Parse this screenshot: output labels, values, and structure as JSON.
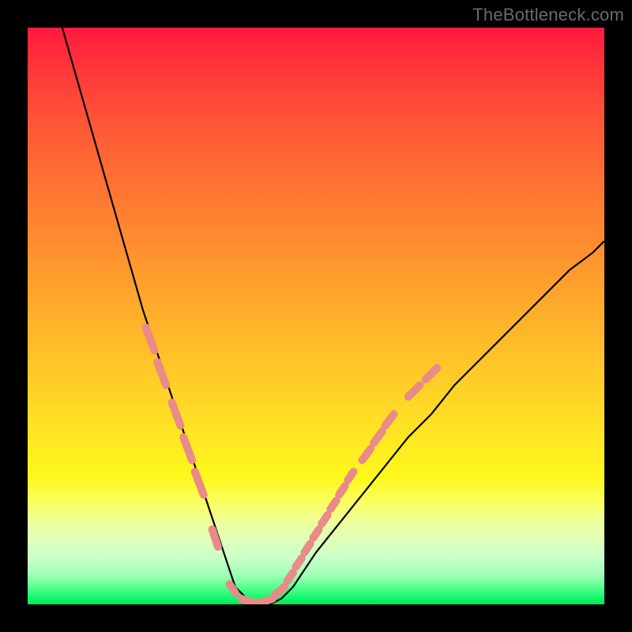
{
  "watermark": {
    "text": "TheBottleneck.com"
  },
  "chart_data": {
    "type": "line",
    "title": "",
    "xlabel": "",
    "ylabel": "",
    "xlim": [
      0,
      100
    ],
    "ylim": [
      0,
      100
    ],
    "grid": false,
    "legend": false,
    "annotations": [],
    "series": [
      {
        "name": "bottleneck-curve",
        "color": "#000000",
        "x": [
          6,
          8,
          10,
          12,
          14,
          16,
          18,
          20,
          22,
          24,
          26,
          28,
          30,
          32,
          33,
          34,
          35,
          36,
          38,
          40,
          42,
          44,
          46,
          48,
          50,
          54,
          58,
          62,
          66,
          70,
          74,
          78,
          82,
          86,
          90,
          94,
          98,
          100
        ],
        "y": [
          100,
          93,
          86,
          79,
          72,
          65,
          58,
          51,
          45,
          39,
          33,
          27,
          21,
          15,
          12,
          9,
          6,
          3,
          1,
          0,
          0,
          1,
          3,
          6,
          9,
          14,
          19,
          24,
          29,
          33,
          38,
          42,
          46,
          50,
          54,
          58,
          61,
          63
        ]
      },
      {
        "name": "salmon-dashes",
        "color": "#e98b87",
        "segments": [
          {
            "x": [
              20.5,
              22.0
            ],
            "y": [
              48.0,
              44.0
            ]
          },
          {
            "x": [
              22.5,
              24.0
            ],
            "y": [
              42.0,
              38.0
            ]
          },
          {
            "x": [
              25.0,
              26.5
            ],
            "y": [
              35.0,
              31.0
            ]
          },
          {
            "x": [
              27.0,
              28.5
            ],
            "y": [
              29.0,
              25.0
            ]
          },
          {
            "x": [
              29.0,
              30.5
            ],
            "y": [
              23.0,
              19.0
            ]
          },
          {
            "x": [
              32.0,
              33.0
            ],
            "y": [
              13.0,
              10.0
            ]
          },
          {
            "x": [
              35.0,
              36.0
            ],
            "y": [
              3.5,
              2.0
            ]
          },
          {
            "x": [
              37.0,
              38.5
            ],
            "y": [
              1.0,
              0.5
            ]
          },
          {
            "x": [
              39.0,
              40.5
            ],
            "y": [
              0.3,
              0.3
            ]
          },
          {
            "x": [
              41.0,
              42.5
            ],
            "y": [
              0.5,
              1.0
            ]
          },
          {
            "x": [
              43.0,
              44.5
            ],
            "y": [
              1.8,
              3.0
            ]
          },
          {
            "x": [
              45.0,
              46.0
            ],
            "y": [
              4.0,
              5.5
            ]
          },
          {
            "x": [
              46.5,
              47.5
            ],
            "y": [
              6.5,
              8.0
            ]
          },
          {
            "x": [
              48.0,
              49.0
            ],
            "y": [
              9.0,
              10.5
            ]
          },
          {
            "x": [
              49.5,
              50.5
            ],
            "y": [
              11.5,
              13.0
            ]
          },
          {
            "x": [
              51.0,
              52.0
            ],
            "y": [
              14.0,
              15.5
            ]
          },
          {
            "x": [
              52.5,
              53.5
            ],
            "y": [
              16.5,
              18.0
            ]
          },
          {
            "x": [
              54.0,
              55.0
            ],
            "y": [
              19.0,
              20.5
            ]
          },
          {
            "x": [
              55.5,
              56.5
            ],
            "y": [
              21.5,
              23.0
            ]
          },
          {
            "x": [
              58.0,
              59.5
            ],
            "y": [
              25.0,
              27.0
            ]
          },
          {
            "x": [
              60.0,
              61.5
            ],
            "y": [
              28.0,
              30.0
            ]
          },
          {
            "x": [
              62.0,
              63.5
            ],
            "y": [
              31.0,
              33.0
            ]
          },
          {
            "x": [
              66.0,
              68.0
            ],
            "y": [
              36.0,
              38.0
            ]
          },
          {
            "x": [
              69.0,
              71.0
            ],
            "y": [
              39.0,
              41.0
            ]
          }
        ]
      }
    ],
    "background": {
      "type": "vertical-gradient",
      "stops": [
        {
          "pos": 0.0,
          "hex": "#ff1a3e"
        },
        {
          "pos": 0.3,
          "hex": "#ff7a32"
        },
        {
          "pos": 0.66,
          "hex": "#ffda26"
        },
        {
          "pos": 0.82,
          "hex": "#faff5c"
        },
        {
          "pos": 0.92,
          "hex": "#c8ffc8"
        },
        {
          "pos": 1.0,
          "hex": "#00e45a"
        }
      ]
    }
  }
}
